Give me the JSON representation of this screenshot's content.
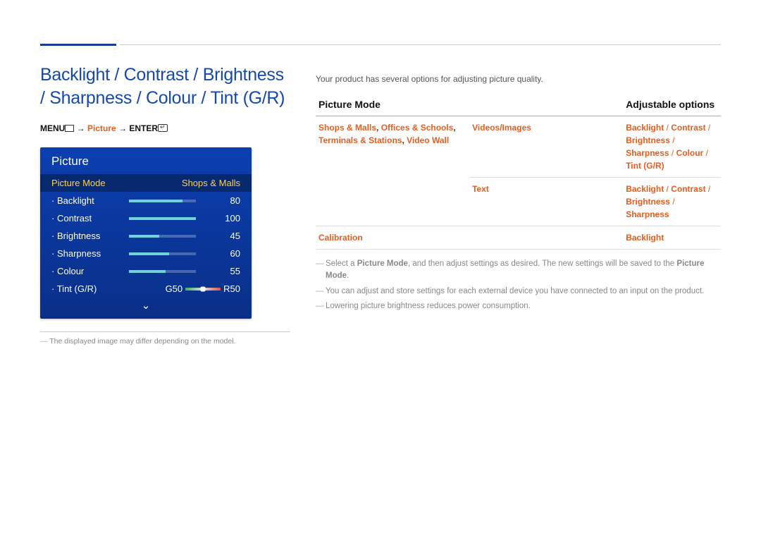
{
  "page_title": "Backlight / Contrast / Brightness / Sharpness / Colour / Tint (G/R)",
  "menu_path": {
    "prefix": "MENU",
    "step1": "Picture",
    "step2": "ENTER"
  },
  "osd": {
    "title": "Picture",
    "mode_label": "Picture Mode",
    "mode_value": "Shops & Malls",
    "items": [
      {
        "label": "Backlight",
        "value": 80,
        "max": 100
      },
      {
        "label": "Contrast",
        "value": 100,
        "max": 100
      },
      {
        "label": "Brightness",
        "value": 45,
        "max": 100
      },
      {
        "label": "Sharpness",
        "value": 60,
        "max": 100
      },
      {
        "label": "Colour",
        "value": 55,
        "max": 100
      }
    ],
    "tint_label": "Tint (G/R)",
    "tint_g": "G50",
    "tint_r": "R50"
  },
  "osd_footnote": "The displayed image may differ depending on the model.",
  "intro": "Your product has several options for adjusting picture quality.",
  "table": {
    "head": [
      "Picture Mode",
      "",
      "Adjustable options"
    ],
    "rows": [
      {
        "mode": "<span class='orange'>Shops & Malls</span><span class='black'>, </span><span class='orange'>Offices & Schools</span><span class='black'>, </span><span class='orange'>Terminals & Stations</span><span class='black'>, </span><span class='orange'>Video Wall</span>",
        "sub": "Videos/Images",
        "opts": "<span class='orange'>Backlight</span> <span class='sep'>/</span> <span class='orange'>Contrast</span> <span class='sep'>/</span> <span class='orange'>Brightness</span> <span class='sep'>/</span> <span class='orange'>Sharpness</span> <span class='sep'>/</span> <span class='orange'>Colour</span> <span class='sep'>/</span> <span class='orange'>Tint (G/R)</span>",
        "rowspan": 2
      },
      {
        "mode": "",
        "sub": "Text",
        "opts": "<span class='orange'>Backlight</span> <span class='sep'>/</span> <span class='orange'>Contrast</span> <span class='sep'>/</span> <span class='orange'>Brightness</span> <span class='sep'>/</span> <span class='orange'>Sharpness</span>"
      },
      {
        "mode": "<span class='orange'>Calibration</span>",
        "sub": "",
        "opts": "<span class='orange'>Backlight</span>"
      }
    ]
  },
  "notes": [
    "Select a <span class='hl k'>Picture Mode</span>, and then adjust settings as desired. The new settings will be saved to the <span class='hl k'>Picture Mode</span>.",
    "You can adjust and store settings for each external device you have connected to an input on the product.",
    "Lowering picture brightness reduces power consumption."
  ]
}
